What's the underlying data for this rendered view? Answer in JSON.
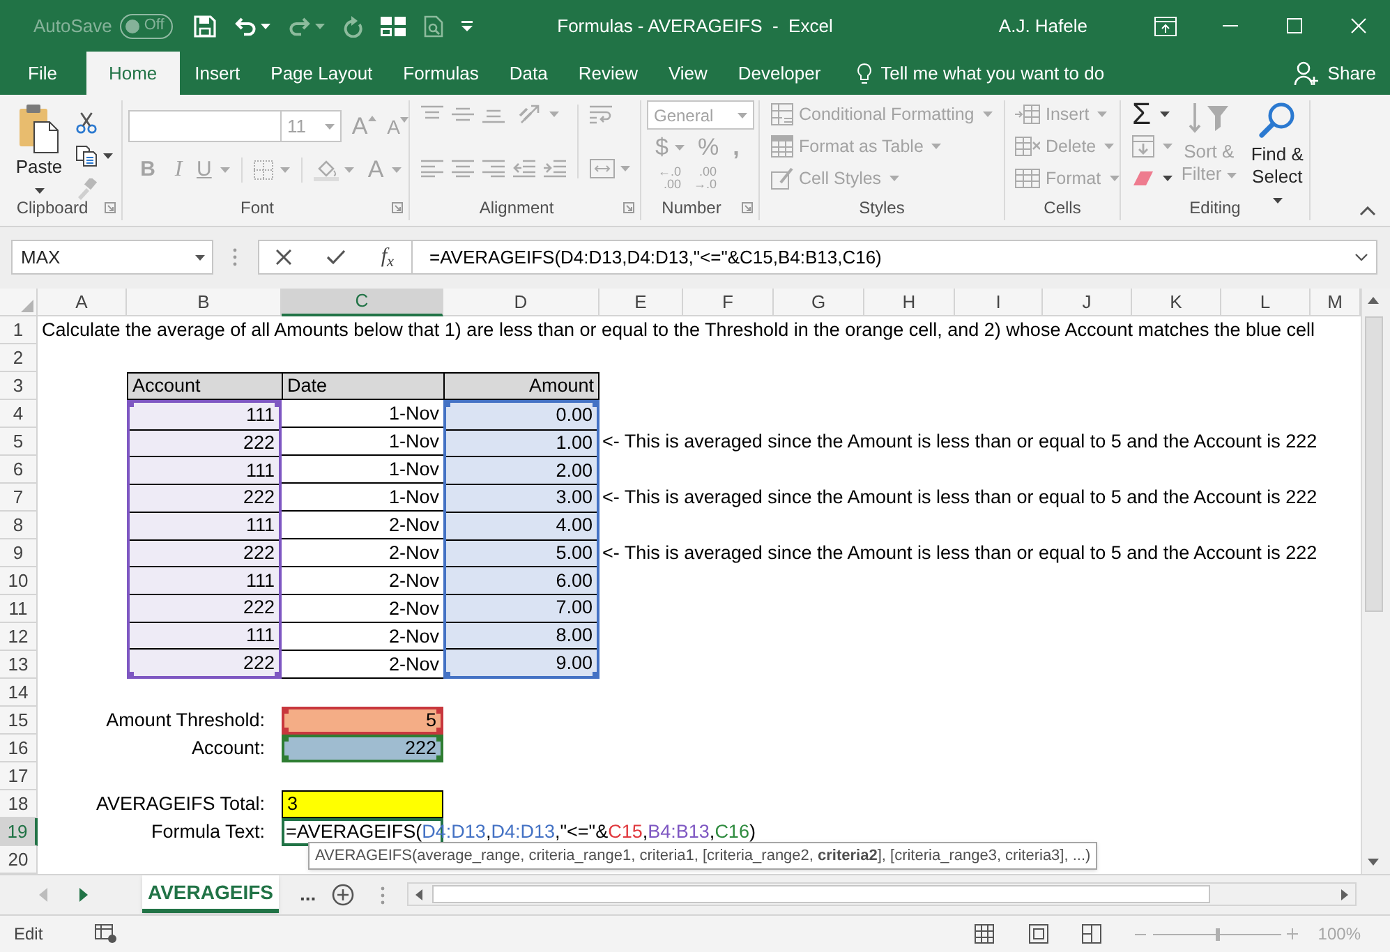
{
  "title_bar": {
    "autosave": {
      "label": "AutoSave",
      "state": "Off",
      "on": false,
      "disabled": true
    },
    "quick_access": [
      {
        "kind": "save",
        "disabled": false
      },
      {
        "kind": "undo",
        "disabled": false
      },
      {
        "kind": "redo",
        "disabled": true
      },
      {
        "kind": "repeat",
        "disabled": true
      },
      {
        "kind": "form",
        "disabled": false
      },
      {
        "kind": "print_preview",
        "disabled": true
      },
      {
        "kind": "customize",
        "disabled": false
      }
    ],
    "title": "Formulas - AVERAGEIFS  -  Excel",
    "user": "A.J. Hafele"
  },
  "ribbon_tabs": [
    {
      "label": "File",
      "selected": false
    },
    {
      "label": "Home",
      "selected": true
    },
    {
      "label": "Insert",
      "selected": false
    },
    {
      "label": "Page Layout",
      "selected": false
    },
    {
      "label": "Formulas",
      "selected": false
    },
    {
      "label": "Data",
      "selected": false
    },
    {
      "label": "Review",
      "selected": false
    },
    {
      "label": "View",
      "selected": false
    },
    {
      "label": "Developer",
      "selected": false
    }
  ],
  "tell_me": {
    "placeholder": "Tell me what you want to do"
  },
  "share": {
    "label": "Share"
  },
  "ribbon": {
    "clipboard": {
      "label": "Clipboard",
      "paste": {
        "label": "Paste",
        "disabled": false
      }
    },
    "font": {
      "label": "Font",
      "disabled": true,
      "size": "11",
      "grow": "A",
      "shrink": "A",
      "bold": "B",
      "italic": "I",
      "underline": "U",
      "font_color": "A"
    },
    "alignment": {
      "label": "Alignment",
      "disabled": true
    },
    "number": {
      "label": "Number",
      "disabled": true,
      "format": "General",
      "currency": "$",
      "percent": "%",
      "comma": ",",
      "increase_decimal": [
        "←.0",
        ".00"
      ],
      "decrease_decimal": [
        ".00",
        "→.0"
      ]
    },
    "styles": {
      "label": "Styles",
      "commands": [
        {
          "kind": "conditional_formatting",
          "label": "Conditional Formatting",
          "disabled": true
        },
        {
          "kind": "format_as_table",
          "label": "Format as Table",
          "disabled": true
        },
        {
          "kind": "cell_styles",
          "label": "Cell Styles",
          "disabled": true
        }
      ]
    },
    "cells": {
      "label": "Cells",
      "commands": [
        {
          "kind": "insert",
          "label": "Insert",
          "disabled": true
        },
        {
          "kind": "delete",
          "label": "Delete",
          "disabled": true
        },
        {
          "kind": "format",
          "label": "Format",
          "disabled": true
        }
      ]
    },
    "editing": {
      "label": "Editing",
      "autosum": {
        "label": "Σ",
        "disabled": false
      },
      "sort_filter": {
        "label": "Sort & Filter",
        "disabled": true
      },
      "find_select": {
        "label": "Find & Select",
        "disabled": false
      }
    }
  },
  "formula_bar": {
    "name_box": "MAX",
    "function_button": "f$_{x}$",
    "formula": "=AVERAGEIFS(D4:D13,D4:D13,\"<=\"&C15,B4:B13,C16)"
  },
  "sheet": {
    "column_headers": [
      {
        "label": "A",
        "selected": false
      },
      {
        "label": "B",
        "selected": false
      },
      {
        "label": "C",
        "selected": true
      },
      {
        "label": "D",
        "selected": false
      },
      {
        "label": "E",
        "selected": false
      },
      {
        "label": "F",
        "selected": false
      },
      {
        "label": "G",
        "selected": false
      },
      {
        "label": "H",
        "selected": false
      },
      {
        "label": "I",
        "selected": false
      },
      {
        "label": "J",
        "selected": false
      },
      {
        "label": "K",
        "selected": false
      },
      {
        "label": "L",
        "selected": false
      },
      {
        "label": "M",
        "selected": false
      }
    ],
    "row_headers": [
      {
        "label": "1",
        "selected": false
      },
      {
        "label": "2",
        "selected": false
      },
      {
        "label": "3",
        "selected": false
      },
      {
        "label": "4",
        "selected": false
      },
      {
        "label": "5",
        "selected": false
      },
      {
        "label": "6",
        "selected": false
      },
      {
        "label": "7",
        "selected": false
      },
      {
        "label": "8",
        "selected": false
      },
      {
        "label": "9",
        "selected": false
      },
      {
        "label": "10",
        "selected": false
      },
      {
        "label": "11",
        "selected": false
      },
      {
        "label": "12",
        "selected": false
      },
      {
        "label": "13",
        "selected": false
      },
      {
        "label": "14",
        "selected": false
      },
      {
        "label": "15",
        "selected": false
      },
      {
        "label": "16",
        "selected": false
      },
      {
        "label": "17",
        "selected": false
      },
      {
        "label": "18",
        "selected": false
      },
      {
        "label": "19",
        "selected": true
      },
      {
        "label": "20",
        "selected": false
      }
    ],
    "instruction": "Calculate the average of all Amounts below that 1) are less than or equal to the Threshold in the orange cell, and 2) whose Account matches the blue cell",
    "table": {
      "columns": [
        {
          "label": "Account",
          "color": "#7e57c2"
        },
        {
          "label": "Date"
        },
        {
          "label": "Amount",
          "color": "#4472c4"
        }
      ],
      "rows": [
        {
          "cells": [
            "111",
            "1-Nov",
            "0.00"
          ]
        },
        {
          "cells": [
            "222",
            "1-Nov",
            "1.00"
          ],
          "note": "<- This is averaged since the Amount is less than or equal to 5 and the Account is 222"
        },
        {
          "cells": [
            "111",
            "1-Nov",
            "2.00"
          ]
        },
        {
          "cells": [
            "222",
            "1-Nov",
            "3.00"
          ],
          "note": "<- This is averaged since the Amount is less than or equal to 5 and the Account is 222"
        },
        {
          "cells": [
            "111",
            "2-Nov",
            "4.00"
          ]
        },
        {
          "cells": [
            "222",
            "2-Nov",
            "5.00"
          ],
          "note": "<- This is averaged since the Amount is less than or equal to 5 and the Account is 222"
        },
        {
          "cells": [
            "111",
            "2-Nov",
            "6.00"
          ]
        },
        {
          "cells": [
            "222",
            "2-Nov",
            "7.00"
          ]
        },
        {
          "cells": [
            "111",
            "2-Nov",
            "8.00"
          ]
        },
        {
          "cells": [
            "222",
            "2-Nov",
            "9.00"
          ]
        }
      ]
    },
    "threshold": {
      "label": "Amount Threshold:",
      "value": "5",
      "color": "#c8373d"
    },
    "account": {
      "label": "Account:",
      "value": "222",
      "color": "#2e7d32"
    },
    "total": {
      "label": "AVERAGEIFS Total:",
      "value": "3"
    },
    "formula_text": {
      "label": "Formula Text:",
      "segments": [
        {
          "text": "=AVERAGEIFS(",
          "color": "#000000"
        },
        {
          "text": "D4:D13",
          "color": "#4472c4"
        },
        {
          "text": ",",
          "color": "#000000"
        },
        {
          "text": "D4:D13",
          "color": "#4472c4"
        },
        {
          "text": ",\"<=\"&",
          "color": "#000000"
        },
        {
          "text": "C15",
          "color": "#e0393e"
        },
        {
          "text": ",",
          "color": "#000000"
        },
        {
          "text": "B4:B13",
          "color": "#7e57c2"
        },
        {
          "text": ",",
          "color": "#000000"
        },
        {
          "text": "C16",
          "color": "#2e8b3e"
        },
        {
          "text": ")",
          "color": "#000000"
        }
      ]
    },
    "tooltip": "AVERAGEIFS(average_range, criteria_range1, criteria1, [criteria_range2, **criteria2**], [criteria_range3, criteria3], ...)"
  },
  "sheet_tabs": [
    {
      "label": "AVERAGEIFS",
      "selected": true
    }
  ],
  "more_sheets": "...",
  "status_bar": {
    "mode": "Edit",
    "zoom": {
      "level": 0.5,
      "label": "100%",
      "disabled": true
    }
  }
}
